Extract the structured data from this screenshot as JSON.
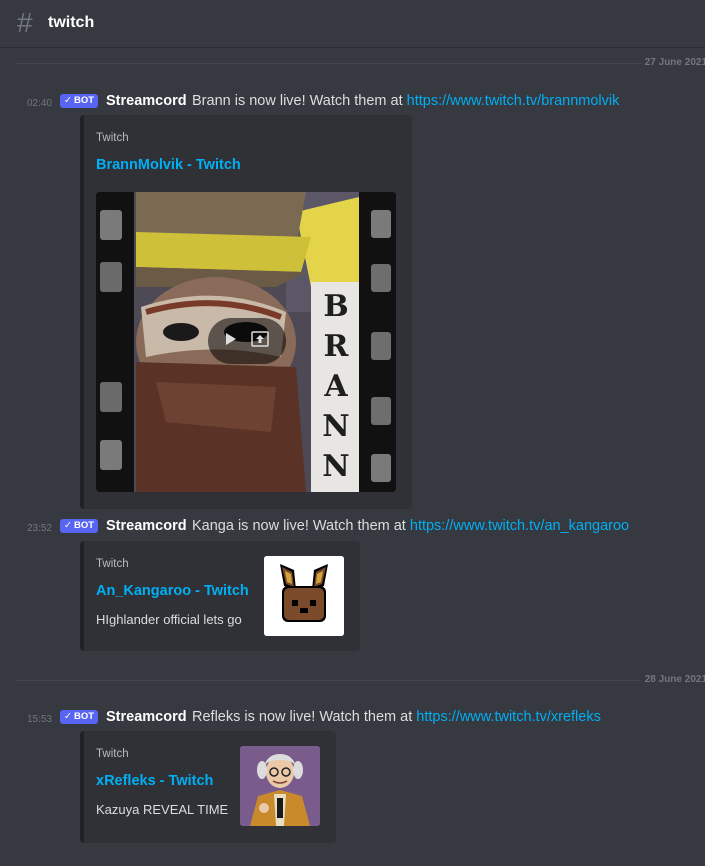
{
  "channel": {
    "name": "twitch"
  },
  "dividers": [
    "27 June 2021",
    "28 June 2021"
  ],
  "messages": [
    {
      "time": "02:40",
      "badge": "BOT",
      "author": "Streamcord",
      "text": "Brann is now live! Watch them at ",
      "link": "https://www.twitch.tv/brannmolvik",
      "embed": {
        "provider": "Twitch",
        "title": "BrannMolvik - Twitch",
        "poster_letters": [
          "B",
          "R",
          "A",
          "N",
          "N"
        ]
      }
    },
    {
      "time": "23:52",
      "badge": "BOT",
      "author": "Streamcord",
      "text": "Kanga is now live! Watch them at ",
      "link": "https://www.twitch.tv/an_kangaroo",
      "embed": {
        "provider": "Twitch",
        "title": "An_Kangaroo - Twitch",
        "description": "HIghlander official lets go"
      }
    },
    {
      "time": "15:53",
      "badge": "BOT",
      "author": "Streamcord",
      "text": "Refleks is now live! Watch them at ",
      "link": "https://www.twitch.tv/xrefleks",
      "embed": {
        "provider": "Twitch",
        "title": "xRefleks - Twitch",
        "description": "Kazuya REVEAL TIME"
      }
    }
  ],
  "colors": {
    "background": "#36393f",
    "embed_bg": "#2f3136",
    "link": "#00aff4",
    "badge": "#5865f2"
  },
  "icons": {
    "channel": "hash-icon",
    "badge_check": "checkmark-icon",
    "play": "play-icon",
    "open_external": "open-external-icon"
  }
}
